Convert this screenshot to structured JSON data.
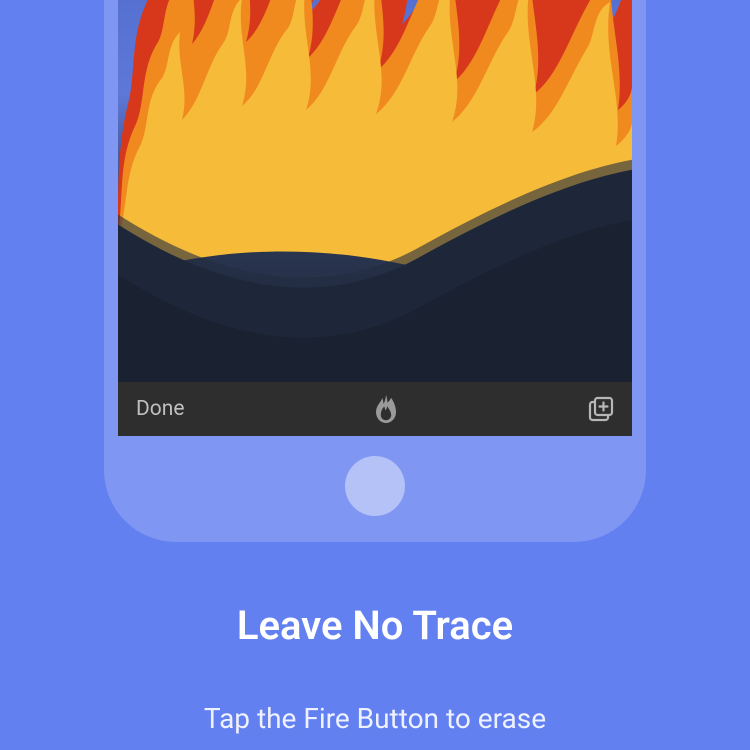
{
  "onboarding": {
    "headline": "Leave No Trace",
    "subtext": "Tap the Fire Button to erase"
  },
  "tabbar": {
    "done_label": "Done",
    "fire_icon_name": "flame-icon",
    "tabs_icon_name": "tabs-add-icon"
  }
}
